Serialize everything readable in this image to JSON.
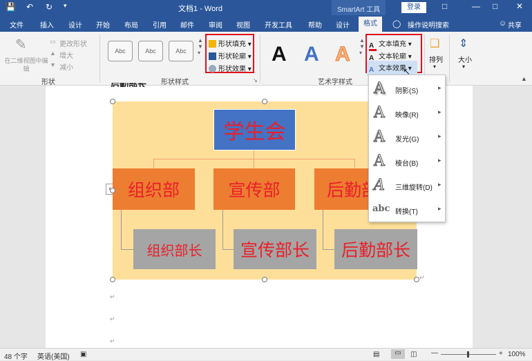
{
  "titlebar": {
    "doc_title": "文档1 - Word",
    "contextual_tab": "SmartArt 工具",
    "login": "登录"
  },
  "tabs": {
    "file": "文件",
    "insert": "插入",
    "design": "设计",
    "home": "开始",
    "layout": "布局",
    "references": "引用",
    "mailings": "邮件",
    "review": "审阅",
    "view": "视图",
    "developer": "开发工具",
    "help": "帮助",
    "sa_design": "设计",
    "sa_format": "格式",
    "tell_me": "操作说明搜索",
    "share": "共享"
  },
  "ribbon": {
    "shapes_group": {
      "edit_2d": "在二维视图中编辑",
      "change_shape": "更改形状",
      "larger": "增大",
      "smaller": "减小",
      "label": "形状"
    },
    "shape_styles": {
      "sample": "Abc",
      "fill": "形状填充",
      "outline": "形状轮廓",
      "effects": "形状效果",
      "label": "形状样式"
    },
    "wordart": {
      "glyph": "A",
      "fill": "文本填充",
      "outline": "文本轮廓",
      "effects": "文本效果",
      "label": "艺术字样式"
    },
    "arrange": "排列",
    "size": "大小"
  },
  "effects_menu": [
    {
      "label": "阴影(S)"
    },
    {
      "label": "映像(R)"
    },
    {
      "label": "发光(G)"
    },
    {
      "label": "棱台(B)"
    },
    {
      "label": "三维旋转(D)"
    },
    {
      "label": "转换(T)"
    }
  ],
  "document": {
    "heading_partial": "后勤部长",
    "smartart": {
      "top": "学生会",
      "level2": [
        "组织部",
        "宣传部",
        "后勤部"
      ],
      "level3": [
        "组织部长",
        "宣传部长",
        "后勤部长"
      ]
    }
  },
  "statusbar": {
    "word_count": "48 个字",
    "language": "英语(美国)",
    "zoom": "100%"
  },
  "colors": {
    "title_blue": "#2b579a",
    "smartart_bg": "#fedf9a",
    "top_node": "#4472c4",
    "level2_node": "#ed7d31",
    "level3_node": "#a5a5a5",
    "node_text": "#e8202a",
    "highlight": "#e0101c"
  }
}
